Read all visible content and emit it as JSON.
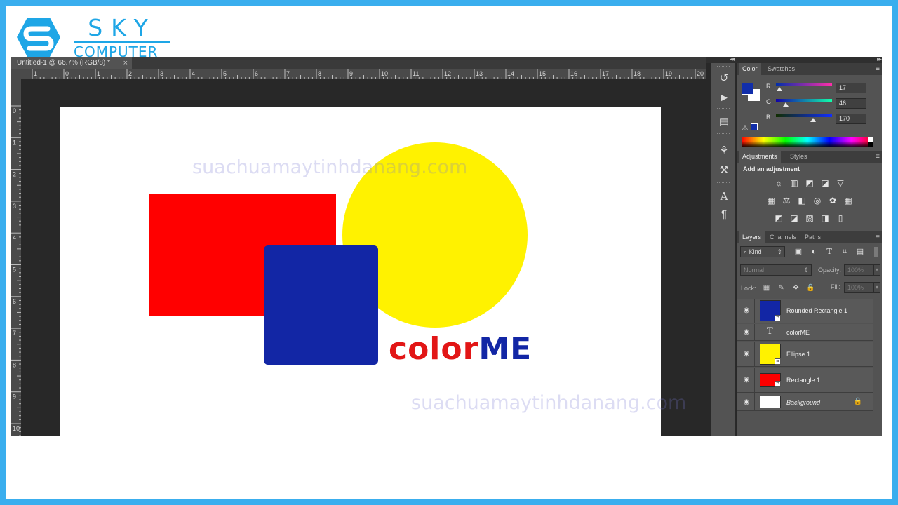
{
  "logo": {
    "top_word": "SKY",
    "bottom_word": "COMPUTER",
    "color": "#1ea6e6"
  },
  "document": {
    "tab_title": "Untitled-1 @ 66.7% (RGB/8) *",
    "close_glyph": "×",
    "ruler_h_labels": [
      "1",
      "0",
      "1",
      "2",
      "3",
      "4",
      "5",
      "6",
      "7",
      "8",
      "9",
      "10",
      "11",
      "12",
      "13",
      "14",
      "15",
      "16",
      "17",
      "18",
      "19",
      "20"
    ],
    "ruler_v_labels": [
      "0",
      "1",
      "2",
      "3",
      "4",
      "5",
      "6",
      "7",
      "8",
      "9",
      "10"
    ],
    "canvas": {
      "brand_part1": "color",
      "brand_part2": "ME",
      "watermark": "suachuamaytinhdanang.com",
      "colors": {
        "rectangle": "#ff0000",
        "ellipse": "#fff200",
        "rounded_rectangle": "#1226a5"
      }
    }
  },
  "panels": {
    "collapse_glyph": "◂◂",
    "expand_glyph": "▸▸",
    "color": {
      "tabs": [
        "Color",
        "Swatches"
      ],
      "foreground": "#112eaa",
      "background": "#ffffff",
      "channels": [
        {
          "label": "R",
          "value": "17",
          "fraction": 0.067
        },
        {
          "label": "G",
          "value": "46",
          "fraction": 0.18
        },
        {
          "label": "B",
          "value": "170",
          "fraction": 0.667
        }
      ],
      "warning_icon": "⚠"
    },
    "adjustments": {
      "tabs": [
        "Adjustments",
        "Styles"
      ],
      "title": "Add an adjustment",
      "rows": [
        [
          "☼",
          "▥",
          "◩",
          "◪",
          "▽"
        ],
        [
          "▦",
          "⚖",
          "◧",
          "◎",
          "✿",
          "▦"
        ],
        [
          "◩",
          "◪",
          "▨",
          "◨",
          "▯"
        ]
      ]
    },
    "layers": {
      "tabs": [
        "Layers",
        "Channels",
        "Paths"
      ],
      "kind_label": "Kind",
      "search_icon": "⌕",
      "filter_icons": [
        "▣",
        "◐",
        "T",
        "⌗",
        "▤"
      ],
      "blend_mode": "Normal",
      "opacity_label": "Opacity:",
      "opacity_value": "100%",
      "lock_label": "Lock:",
      "lock_icons": [
        "▦",
        "✎",
        "✥",
        "🔒"
      ],
      "fill_label": "Fill:",
      "fill_value": "100%",
      "items": [
        {
          "name": "Rounded Rectangle 1",
          "thumb": "#1226a5",
          "type": "shape"
        },
        {
          "name": "colorME",
          "type": "text"
        },
        {
          "name": "Ellipse 1",
          "thumb": "#fff200",
          "type": "shape"
        },
        {
          "name": "Rectangle 1",
          "thumb": "#ff0000",
          "type": "shape"
        },
        {
          "name": "Background",
          "thumb": "#ffffff",
          "type": "background",
          "locked": true
        }
      ]
    }
  }
}
